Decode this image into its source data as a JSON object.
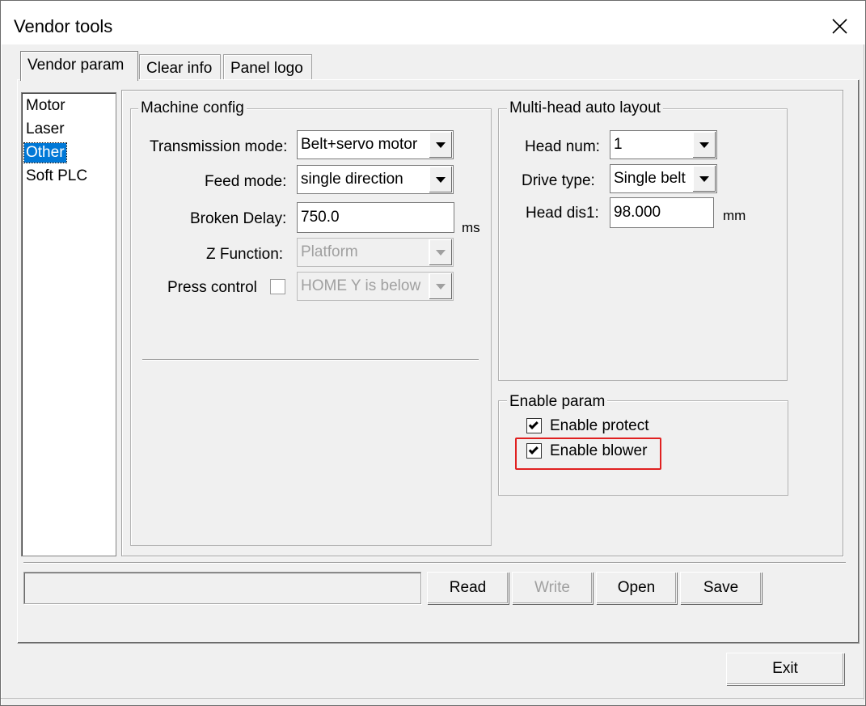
{
  "window": {
    "title": "Vendor tools",
    "close_icon": "close-icon"
  },
  "tabs": [
    {
      "label": "Vendor param",
      "active": true
    },
    {
      "label": "Clear info",
      "active": false
    },
    {
      "label": "Panel logo",
      "active": false
    }
  ],
  "categories": [
    {
      "label": "Motor",
      "selected": false
    },
    {
      "label": "Laser",
      "selected": false
    },
    {
      "label": "Other",
      "selected": true
    },
    {
      "label": "Soft PLC",
      "selected": false
    }
  ],
  "machine_config": {
    "title": "Machine config",
    "transmission_mode": {
      "label": "Transmission mode:",
      "value": "Belt+servo motor"
    },
    "feed_mode": {
      "label": "Feed mode:",
      "value": "single direction"
    },
    "broken_delay": {
      "label": "Broken Delay:",
      "value": "750.0",
      "unit": "ms"
    },
    "z_function": {
      "label": "Z Function:",
      "value": "Platform",
      "disabled": true
    },
    "press_control": {
      "label": "Press control",
      "checked": false,
      "value": "HOME Y is below",
      "disabled": true
    }
  },
  "multi_head": {
    "title": "Multi-head auto layout",
    "head_num": {
      "label": "Head num:",
      "value": "1"
    },
    "drive_type": {
      "label": "Drive type:",
      "value": "Single belt"
    },
    "head_dis1": {
      "label": "Head dis1:",
      "value": "98.000",
      "unit": "mm"
    }
  },
  "enable_param": {
    "title": "Enable param",
    "enable_protect": {
      "label": "Enable protect",
      "checked": true
    },
    "enable_blower": {
      "label": "Enable blower",
      "checked": true
    }
  },
  "actions": {
    "status_text": "",
    "read": "Read",
    "write": "Write",
    "open": "Open",
    "save": "Save",
    "exit": "Exit"
  },
  "colors": {
    "selection": "#0078d7",
    "highlight": "#e02020",
    "dialog_bg": "#f0f0f0"
  }
}
